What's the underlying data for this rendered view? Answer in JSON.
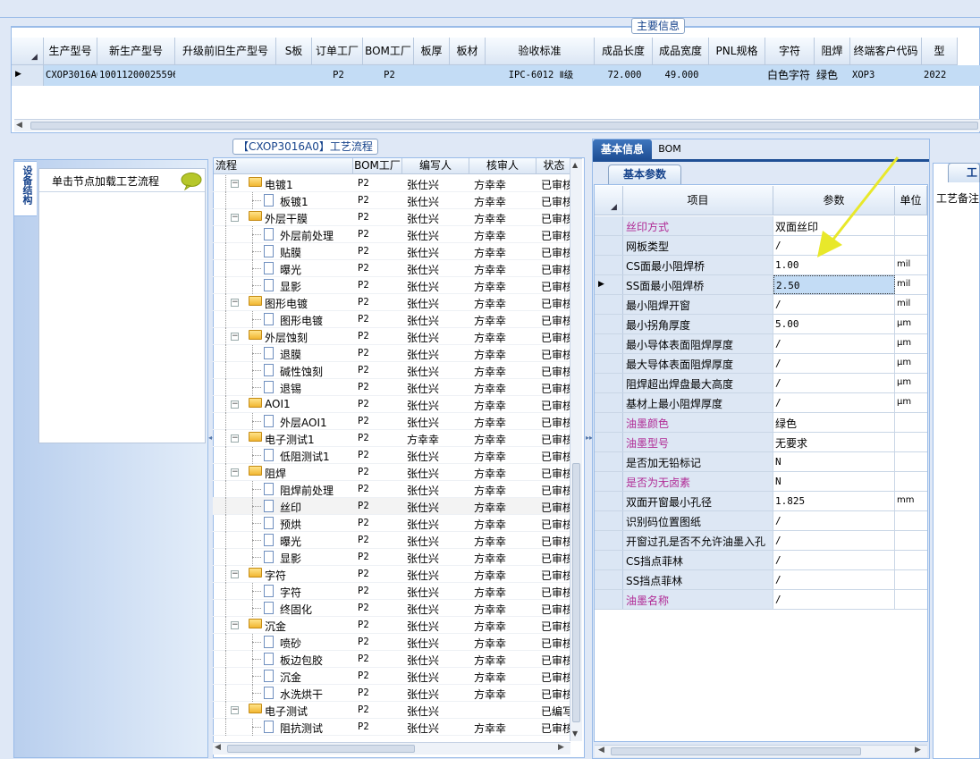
{
  "main_info": {
    "title": "主要信息",
    "columns": [
      "生产型号",
      "新生产型号",
      "升级前旧生产型号",
      "S板",
      "订单工厂",
      "BOM工厂",
      "板厚",
      "板材",
      "验收标准",
      "成品长度",
      "成品宽度",
      "PNL规格",
      "字符",
      "阻焊",
      "终端客户代码",
      "型"
    ],
    "row": [
      "CXOP3016A0",
      "10011200025596",
      "",
      "",
      "P2",
      "P2",
      "",
      "",
      "IPC-6012 Ⅱ级",
      "72.000",
      "49.000",
      "",
      "白色字符",
      "绿色",
      "XOP3",
      "2022"
    ]
  },
  "equipment": {
    "tab": "设备结构",
    "hint": "单击节点加载工艺流程"
  },
  "process": {
    "title": "【CXOP3016A0】工艺流程",
    "columns": [
      "流程",
      "BOM工厂",
      "编写人",
      "核审人",
      "状态"
    ],
    "rows": [
      {
        "name": "电镀1",
        "level": 1,
        "bom": "P2",
        "writer": "张仕兴",
        "reviewer": "方幸幸",
        "status": "已审核"
      },
      {
        "name": "板镀1",
        "level": 2,
        "bom": "P2",
        "writer": "张仕兴",
        "reviewer": "方幸幸",
        "status": "已审核"
      },
      {
        "name": "外层干膜",
        "level": 1,
        "bom": "P2",
        "writer": "张仕兴",
        "reviewer": "方幸幸",
        "status": "已审核"
      },
      {
        "name": "外层前处理",
        "level": 2,
        "bom": "P2",
        "writer": "张仕兴",
        "reviewer": "方幸幸",
        "status": "已审核"
      },
      {
        "name": "贴膜",
        "level": 2,
        "bom": "P2",
        "writer": "张仕兴",
        "reviewer": "方幸幸",
        "status": "已审核"
      },
      {
        "name": "曝光",
        "level": 2,
        "bom": "P2",
        "writer": "张仕兴",
        "reviewer": "方幸幸",
        "status": "已审核"
      },
      {
        "name": "显影",
        "level": 2,
        "bom": "P2",
        "writer": "张仕兴",
        "reviewer": "方幸幸",
        "status": "已审核"
      },
      {
        "name": "图形电镀",
        "level": 1,
        "bom": "P2",
        "writer": "张仕兴",
        "reviewer": "方幸幸",
        "status": "已审核"
      },
      {
        "name": "图形电镀",
        "level": 2,
        "bom": "P2",
        "writer": "张仕兴",
        "reviewer": "方幸幸",
        "status": "已审核"
      },
      {
        "name": "外层蚀刻",
        "level": 1,
        "bom": "P2",
        "writer": "张仕兴",
        "reviewer": "方幸幸",
        "status": "已审核"
      },
      {
        "name": "退膜",
        "level": 2,
        "bom": "P2",
        "writer": "张仕兴",
        "reviewer": "方幸幸",
        "status": "已审核"
      },
      {
        "name": "碱性蚀刻",
        "level": 2,
        "bom": "P2",
        "writer": "张仕兴",
        "reviewer": "方幸幸",
        "status": "已审核"
      },
      {
        "name": "退锡",
        "level": 2,
        "bom": "P2",
        "writer": "张仕兴",
        "reviewer": "方幸幸",
        "status": "已审核"
      },
      {
        "name": "AOI1",
        "level": 1,
        "bom": "P2",
        "writer": "张仕兴",
        "reviewer": "方幸幸",
        "status": "已审核"
      },
      {
        "name": "外层AOI1",
        "level": 2,
        "bom": "P2",
        "writer": "张仕兴",
        "reviewer": "方幸幸",
        "status": "已审核"
      },
      {
        "name": "电子测试1",
        "level": 1,
        "bom": "P2",
        "writer": "方幸幸",
        "reviewer": "方幸幸",
        "status": "已审核"
      },
      {
        "name": "低阻测试1",
        "level": 2,
        "bom": "P2",
        "writer": "张仕兴",
        "reviewer": "方幸幸",
        "status": "已审核"
      },
      {
        "name": "阻焊",
        "level": 1,
        "bom": "P2",
        "writer": "张仕兴",
        "reviewer": "方幸幸",
        "status": "已审核"
      },
      {
        "name": "阻焊前处理",
        "level": 2,
        "bom": "P2",
        "writer": "张仕兴",
        "reviewer": "方幸幸",
        "status": "已审核"
      },
      {
        "name": "丝印",
        "level": 2,
        "bom": "P2",
        "writer": "张仕兴",
        "reviewer": "方幸幸",
        "status": "已审核",
        "selected": true
      },
      {
        "name": "预烘",
        "level": 2,
        "bom": "P2",
        "writer": "张仕兴",
        "reviewer": "方幸幸",
        "status": "已审核"
      },
      {
        "name": "曝光",
        "level": 2,
        "bom": "P2",
        "writer": "张仕兴",
        "reviewer": "方幸幸",
        "status": "已审核"
      },
      {
        "name": "显影",
        "level": 2,
        "bom": "P2",
        "writer": "张仕兴",
        "reviewer": "方幸幸",
        "status": "已审核"
      },
      {
        "name": "字符",
        "level": 1,
        "bom": "P2",
        "writer": "张仕兴",
        "reviewer": "方幸幸",
        "status": "已审核"
      },
      {
        "name": "字符",
        "level": 2,
        "bom": "P2",
        "writer": "张仕兴",
        "reviewer": "方幸幸",
        "status": "已审核"
      },
      {
        "name": "终固化",
        "level": 2,
        "bom": "P2",
        "writer": "张仕兴",
        "reviewer": "方幸幸",
        "status": "已审核"
      },
      {
        "name": "沉金",
        "level": 1,
        "bom": "P2",
        "writer": "张仕兴",
        "reviewer": "方幸幸",
        "status": "已审核"
      },
      {
        "name": "喷砂",
        "level": 2,
        "bom": "P2",
        "writer": "张仕兴",
        "reviewer": "方幸幸",
        "status": "已审核"
      },
      {
        "name": "板边包胶",
        "level": 2,
        "bom": "P2",
        "writer": "张仕兴",
        "reviewer": "方幸幸",
        "status": "已审核"
      },
      {
        "name": "沉金",
        "level": 2,
        "bom": "P2",
        "writer": "张仕兴",
        "reviewer": "方幸幸",
        "status": "已审核"
      },
      {
        "name": "水洗烘干",
        "level": 2,
        "bom": "P2",
        "writer": "张仕兴",
        "reviewer": "方幸幸",
        "status": "已审核"
      },
      {
        "name": "电子测试",
        "level": 1,
        "bom": "P2",
        "writer": "张仕兴",
        "reviewer": "",
        "status": "已编写"
      },
      {
        "name": "阻抗测试",
        "level": 2,
        "bom": "P2",
        "writer": "张仕兴",
        "reviewer": "方幸幸",
        "status": "已审核"
      }
    ]
  },
  "basic": {
    "tabs": [
      "基本信息",
      "BOM"
    ],
    "subtab": "基本参数",
    "columns": [
      "项目",
      "参数",
      "单位"
    ],
    "rows": [
      {
        "item": "丝印方式",
        "value": "双面丝印",
        "unit": "",
        "pink": true
      },
      {
        "item": "网板类型",
        "value": "/",
        "unit": ""
      },
      {
        "item": "CS面最小阻焊桥",
        "value": "1.00",
        "unit": "mil"
      },
      {
        "item": "SS面最小阻焊桥",
        "value": "2.50",
        "unit": "mil",
        "current": true
      },
      {
        "item": "最小阻焊开窗",
        "value": "/",
        "unit": "mil"
      },
      {
        "item": "最小拐角厚度",
        "value": "5.00",
        "unit": "μm"
      },
      {
        "item": "最小导体表面阻焊厚度",
        "value": "/",
        "unit": "μm"
      },
      {
        "item": "最大导体表面阻焊厚度",
        "value": "/",
        "unit": "μm"
      },
      {
        "item": "阻焊超出焊盘最大高度",
        "value": "/",
        "unit": "μm"
      },
      {
        "item": "基材上最小阻焊厚度",
        "value": "/",
        "unit": "μm"
      },
      {
        "item": "油墨颜色",
        "value": "绿色",
        "unit": "",
        "pink": true
      },
      {
        "item": "油墨型号",
        "value": "无要求",
        "unit": "",
        "pink": true
      },
      {
        "item": "是否加无铅标记",
        "value": "N",
        "unit": ""
      },
      {
        "item": "是否为无卤素",
        "value": "N",
        "unit": "",
        "pink": true
      },
      {
        "item": "双面开窗最小孔径",
        "value": "1.825",
        "unit": "mm"
      },
      {
        "item": "识别码位置图纸",
        "value": "/",
        "unit": ""
      },
      {
        "item": "开窗过孔是否不允许油墨入孔",
        "value": "/",
        "unit": ""
      },
      {
        "item": "CS挡点菲林",
        "value": "/",
        "unit": ""
      },
      {
        "item": "SS挡点菲林",
        "value": "/",
        "unit": ""
      },
      {
        "item": "油墨名称",
        "value": "/",
        "unit": "",
        "pink": true
      }
    ]
  },
  "notes": {
    "tab": "工",
    "label": "工艺备注"
  }
}
